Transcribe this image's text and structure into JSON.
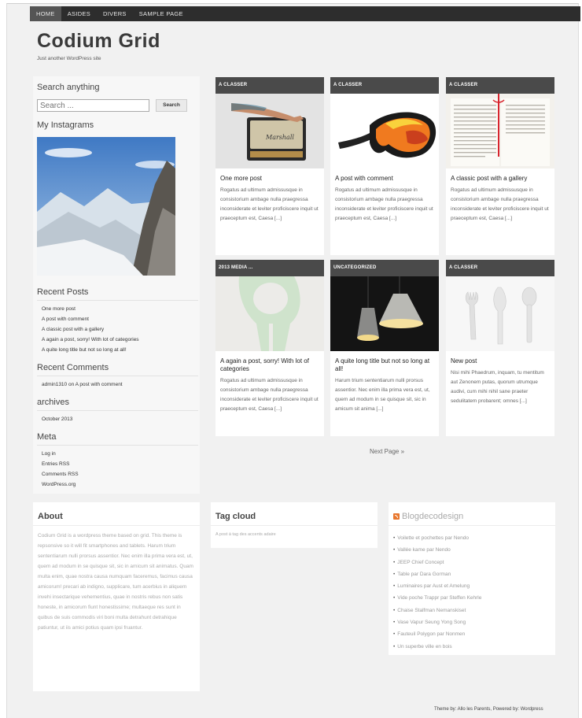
{
  "nav": {
    "items": [
      {
        "label": "HOME"
      },
      {
        "label": "ASIDES"
      },
      {
        "label": "DIVERS"
      },
      {
        "label": "SAMPLE PAGE"
      }
    ]
  },
  "site": {
    "title": "Codium Grid",
    "tagline": "Just another WordPress site"
  },
  "sidebar": {
    "search_title": "Search anything",
    "search_placeholder": "Search ...",
    "search_button": "Search",
    "instagram_title": "My Instagrams",
    "recent_posts_title": "Recent Posts",
    "recent_posts": [
      "One more post",
      "A post with comment",
      "A classic post with a gallery",
      "A again a post, sorry! With lot of categories",
      "A quite long title but not so long at all!"
    ],
    "recent_comments_title": "Recent Comments",
    "recent_comments": [
      "admin1310 on A post with comment"
    ],
    "archives_title": "archives",
    "archives": [
      "October 2013"
    ],
    "meta_title": "Meta",
    "meta": [
      "Log in",
      "Entries RSS",
      "Comments RSS",
      "WordPress.org"
    ]
  },
  "posts": [
    {
      "category": "A CLASSER",
      "title": "One more post",
      "excerpt": "Rogatus ad ultimum admissusque in consistorium ambage nulla praegressa inconsiderate et leviter proficiscere inquit ut praeceptum est, Caesa [...]"
    },
    {
      "category": "A CLASSER",
      "title": "A post with comment",
      "excerpt": "Rogatus ad ultimum admissusque in consistorium ambage nulla praegressa inconsiderate et leviter proficiscere inquit ut praeceptum est, Caesa [...]"
    },
    {
      "category": "A CLASSER",
      "title": "A classic post with a gallery",
      "excerpt": "Rogatus ad ultimum admissusque in consistorium ambage nulla praegressa inconsiderate et leviter proficiscere inquit ut praeceptum est, Caesa [...]"
    },
    {
      "category": "2013 MEDIA ...",
      "title": "A again a post, sorry! With lot of categories",
      "excerpt": "Rogatus ad ultimum admissusque in consistorium ambage nulla praegressa inconsiderate et leviter proficiscere inquit ut praeceptum est, Caesa [...]"
    },
    {
      "category": "UNCATEGORIZED",
      "title": "A quite long title but not so long at all!",
      "excerpt": "Harum trium sententiarum nulli prorsus assentior. Nec enim illa prima vera est, ut, quem ad modum in se quisque sit, sic in amicum sit animа [...]"
    },
    {
      "category": "A CLASSER",
      "title": "New post",
      "excerpt": "Nisi mihi Phaedrum, inquam, tu mentitum aut Zenonem putas, quorum utrumque audivi, cum mihi nihil sane praeter sedulitatem probarent; omnes [...]"
    }
  ],
  "pagination": {
    "next": "Next Page »"
  },
  "footer": {
    "about_title": "About",
    "about_text": "Codium Grid is a wordpress theme based on grid. This theme is repsonsive so it will fit smartphones and tablets. Harum trium sententiarum nulli prorsus assentior. Nec enim illa prima vera est, ut, quem ad modum in se quisque sit, sic in amicum sit animatus. Quam multa enim, quae nostra causa numquam faceremus, facimus causa amicorum! precari ab indigno, supplicare, tum acerbius in aliquem invehi insectarique vehementius, quae in nostris rebus non satis honeste, in amicorum fiunt honestissime; multaeque res sunt in quibus de suis commodis viri boni multa detrahunt detrahique patiuntur, ut iis amici potius quam ipsi fruantur.",
    "tagcloud_title": "Tag cloud",
    "tagcloud_text": "A post à tag des accents adaire",
    "feed_title": "Blogdecodesign",
    "feed_items": [
      "Voilette et pochettes par Nendo",
      "Vallée kame par Nendo",
      "JEEP Chief Concept",
      "Table par Dara Gorman",
      "Luminaires par Aust et Amelung",
      "Vide poche Trappr par Steffen Kehrle",
      "Chaise Stalfman Nemanskiset",
      "Vase Vapur Seung Yong Song",
      "Fauteuil Polygon par Nonmen",
      "Un superbe ville en bois"
    ]
  },
  "credits": "Theme by: Allo les Parents, Powered by: Wordpress"
}
